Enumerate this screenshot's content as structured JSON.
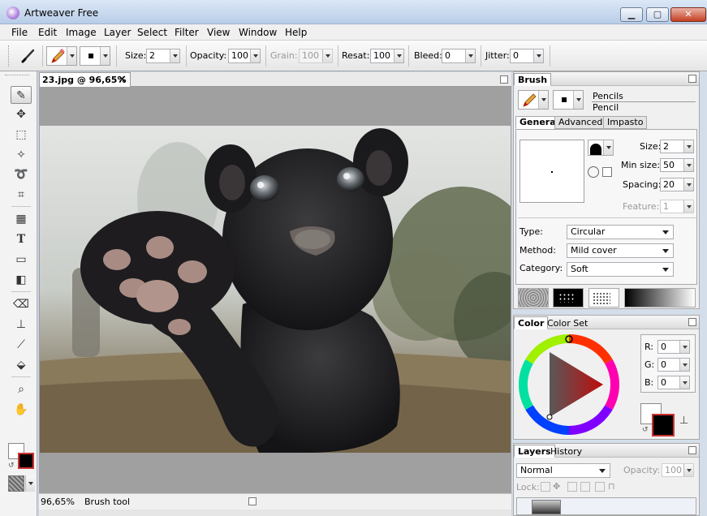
{
  "window": {
    "title": "Artweaver Free",
    "minimize": "▁",
    "maximize": "▢",
    "close": "✕"
  },
  "menu": [
    "File",
    "Edit",
    "Image",
    "Layer",
    "Select",
    "Filter",
    "View",
    "Window",
    "Help"
  ],
  "options": {
    "size_label": "Size:",
    "size_value": "2",
    "opacity_label": "Opacity:",
    "opacity_value": "100",
    "grain_label": "Grain:",
    "grain_value": "100",
    "resat_label": "Resat:",
    "resat_value": "100",
    "bleed_label": "Bleed:",
    "bleed_value": "0",
    "jitter_label": "Jitter:",
    "jitter_value": "0",
    "brush_tip": "▪"
  },
  "document": {
    "tab_title": "23.jpg @ 96,65%",
    "tab_close": "✕"
  },
  "status": {
    "zoom": "96,65%",
    "tool": "Brush tool"
  },
  "brush_panel": {
    "title": "Brush",
    "category": "Pencils",
    "variant": "Pencil",
    "tip": "▪",
    "tabs": [
      "General",
      "Advanced",
      "Impasto"
    ],
    "size_label": "Size:",
    "size_value": "2",
    "minsize_label": "Min size:",
    "minsize_value": "50",
    "spacing_label": "Spacing:",
    "spacing_value": "20",
    "feature_label": "Feature:",
    "feature_value": "1",
    "type_label": "Type:",
    "type_value": "Circular",
    "method_label": "Method:",
    "method_value": "Mild cover",
    "category_label": "Category:",
    "category_value": "Soft"
  },
  "color_panel": {
    "tabs": [
      "Color",
      "Color Set"
    ],
    "r_label": "R:",
    "r_value": "0",
    "g_label": "G:",
    "g_value": "0",
    "b_label": "B:",
    "b_value": "0",
    "primary": "#000000",
    "secondary": "#ffffff"
  },
  "layers_panel": {
    "tabs": [
      "Layers",
      "History"
    ],
    "blend_value": "Normal",
    "opacity_label": "Opacity:",
    "opacity_value": "100",
    "lock_label": "Lock:"
  },
  "icons": {
    "brush": "✎",
    "move": "✥",
    "select": "⬚",
    "wand": "✧",
    "lasso": "➰",
    "crop": "⌗",
    "perspective": "▦",
    "text": "T",
    "shape": "▭",
    "gradient": "◧",
    "eraser": "⌫",
    "stamp": "⊥",
    "eyedropper": "⟋",
    "bucket": "⬙",
    "zoom": "⌕",
    "hand": "✋"
  }
}
